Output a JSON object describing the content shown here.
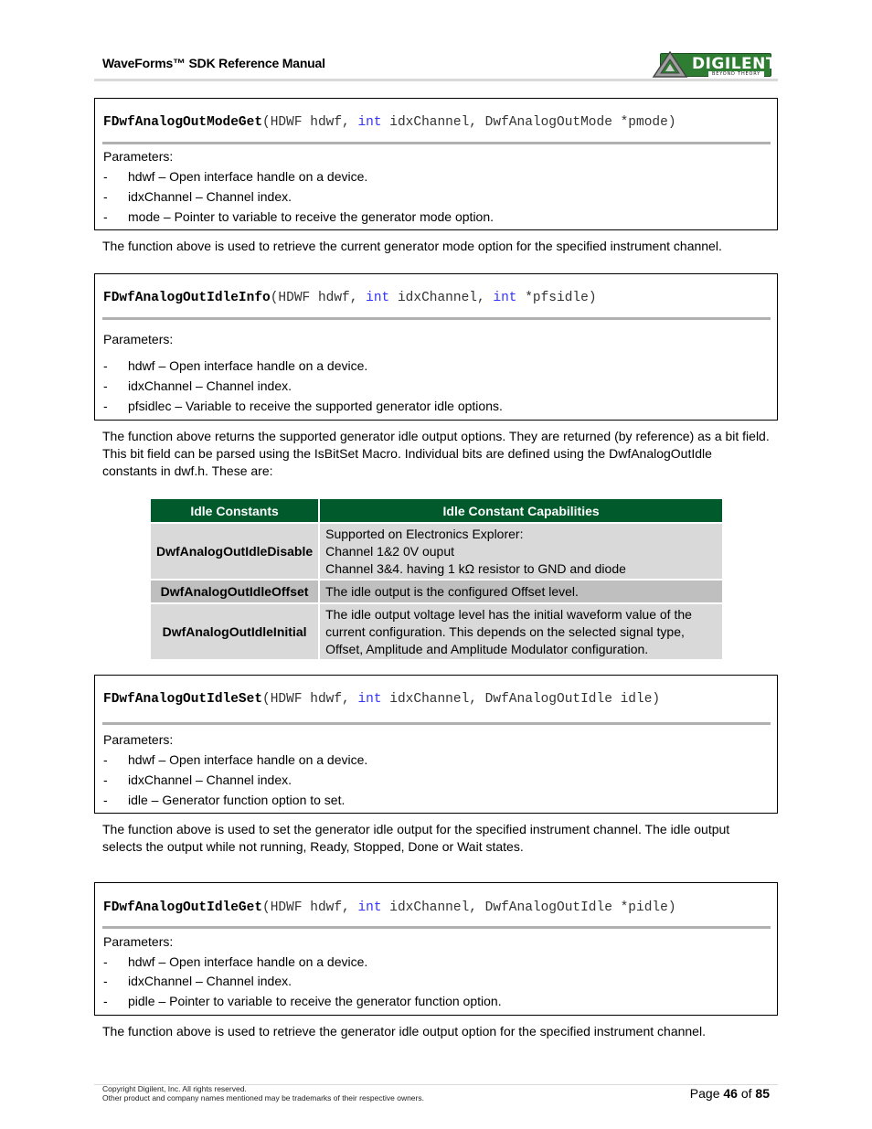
{
  "header": {
    "title": "WaveForms™ SDK Reference Manual",
    "logo_text": "DIGILENT",
    "logo_tagline": "BEYOND THEORY"
  },
  "functions": [
    {
      "name": "FDwfAnalogOutModeGet",
      "sig_a": "(HDWF hdwf, ",
      "kw1": "int",
      "sig_b": " idxChannel, DwfAnalogOutMode *pmode)",
      "kw2": "",
      "sig_c": "",
      "params_label": "Parameters:",
      "params": [
        "hdwf – Open interface handle on a device.",
        "idxChannel – Channel index.",
        "mode – Pointer to variable to receive the generator mode option."
      ],
      "description": "The function above is used to retrieve the current generator mode option for the specified instrument channel."
    },
    {
      "name": "FDwfAnalogOutIdleInfo",
      "sig_a": "(HDWF hdwf, ",
      "kw1": "int",
      "sig_b": " idxChannel, ",
      "kw2": "int",
      "sig_c": " *pfsidle)",
      "params_label": "Parameters:",
      "params": [
        "hdwf – Open interface handle on a device.",
        "idxChannel – Channel index.",
        "pfsidlec – Variable to receive the supported generator idle options."
      ],
      "description": "The function above returns the supported generator idle output options. They are returned (by reference) as a bit field. This bit field can be parsed using the IsBitSet Macro. Individual bits are defined using the DwfAnalogOutIdle constants in dwf.h. These are:"
    },
    {
      "name": "FDwfAnalogOutIdleSet",
      "sig_a": "(HDWF hdwf, ",
      "kw1": "int",
      "sig_b": " idxChannel, DwfAnalogOutIdle idle)",
      "kw2": "",
      "sig_c": "",
      "params_label": "Parameters:",
      "params": [
        "hdwf – Open interface handle on a device.",
        "idxChannel – Channel index.",
        "idle – Generator function option to set."
      ],
      "description": "The function above is used to set the generator idle output for the specified instrument channel. The idle output selects the output while not running, Ready, Stopped, Done or Wait states."
    },
    {
      "name": "FDwfAnalogOutIdleGet",
      "sig_a": "(HDWF hdwf, ",
      "kw1": "int",
      "sig_b": " idxChannel, DwfAnalogOutIdle *pidle)",
      "kw2": "",
      "sig_c": "",
      "params_label": "Parameters:",
      "params": [
        "hdwf – Open interface handle on a device.",
        "idxChannel – Channel index.",
        "pidle – Pointer to variable to receive the generator function option."
      ],
      "description": "The function above is used to retrieve the generator idle output option for the specified instrument channel."
    }
  ],
  "idle_table": {
    "headers": [
      "Idle Constants",
      "Idle Constant Capabilities"
    ],
    "rows": [
      {
        "constant": "DwfAnalogOutIdleDisable",
        "lines": [
          "Supported on Electronics Explorer:",
          "Channel 1&2 0V ouput",
          "Channel 3&4. having 1 kΩ resistor to GND and diode"
        ]
      },
      {
        "constant": "DwfAnalogOutIdleOffset",
        "lines": [
          "The idle output is the configured Offset level."
        ]
      },
      {
        "constant": "DwfAnalogOutIdleInitial",
        "lines": [
          "The idle output voltage level has the initial waveform value of the",
          "current configuration. This depends on the selected signal type,",
          "Offset, Amplitude and Amplitude Modulator configuration."
        ]
      }
    ],
    "colors": {
      "header_bg": "#005a2b",
      "row_light": "#d9d9d9",
      "row_dark": "#bfbfbf"
    }
  },
  "colors": {
    "keyword": "#3333ff",
    "brand_green": "#2e7d32"
  },
  "footer": {
    "copyright": "Copyright Digilent, Inc. All rights reserved.",
    "trademark": "Other product and company names mentioned may be trademarks of their respective owners.",
    "page_prefix": "Page ",
    "page_current": "46",
    "page_mid": " of ",
    "page_total": "85"
  }
}
